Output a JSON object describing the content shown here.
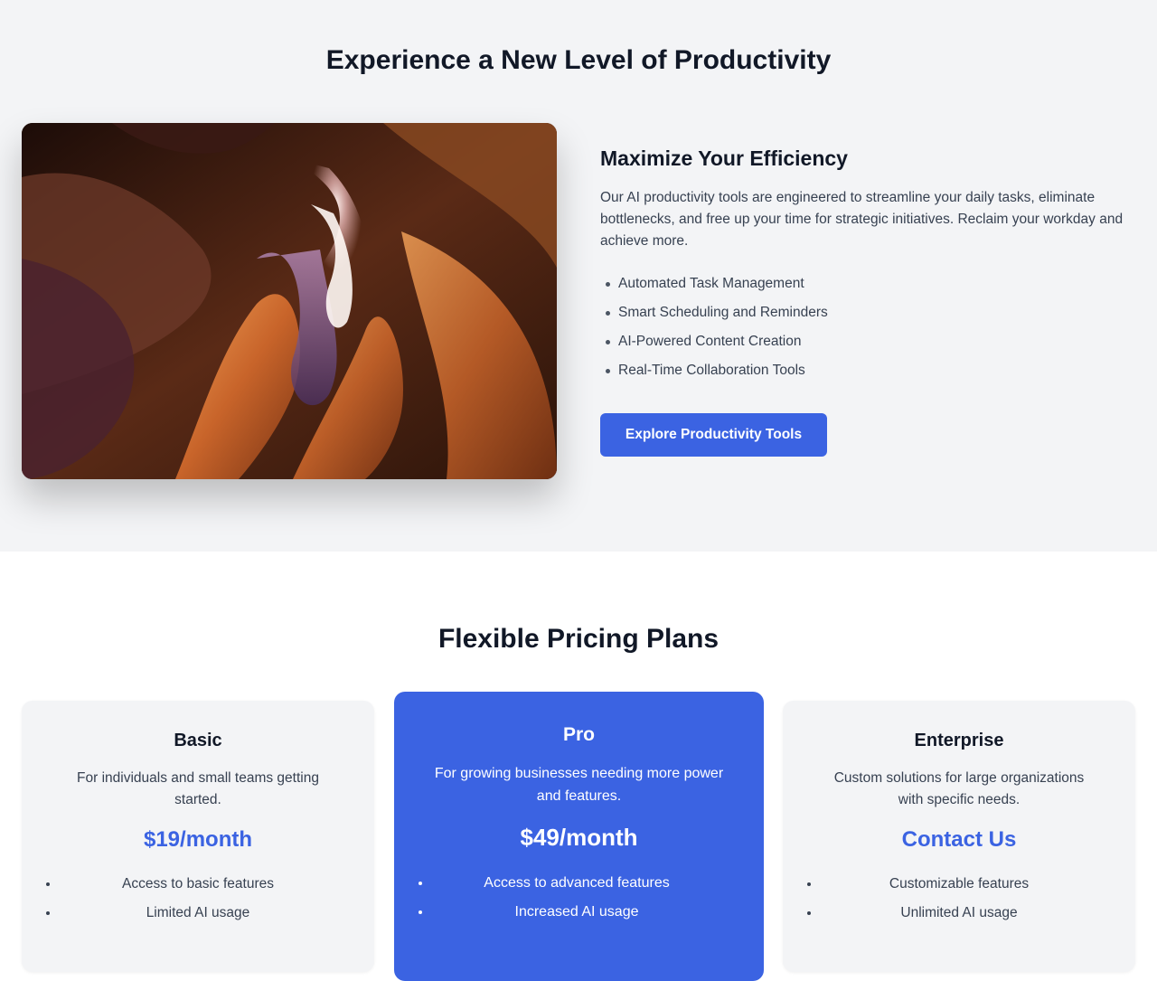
{
  "productivity": {
    "title": "Experience a New Level of Productivity",
    "image": {
      "alt": "canyon-photo"
    },
    "subtitle": "Maximize Your Efficiency",
    "description": "Our AI productivity tools are engineered to streamline your daily tasks, eliminate bottlenecks, and free up your time for strategic initiatives. Reclaim your workday and achieve more.",
    "features": [
      "Automated Task Management",
      "Smart Scheduling and Reminders",
      "AI-Powered Content Creation",
      "Real-Time Collaboration Tools"
    ],
    "cta_label": "Explore Productivity Tools"
  },
  "pricing": {
    "title": "Flexible Pricing Plans",
    "plans": [
      {
        "name": "Basic",
        "description": "For individuals and small teams getting started.",
        "price": "$19/month",
        "features": [
          "Access to basic features",
          "Limited AI usage"
        ]
      },
      {
        "name": "Pro",
        "description": "For growing businesses needing more power and features.",
        "price": "$49/month",
        "features": [
          "Access to advanced features",
          "Increased AI usage"
        ]
      },
      {
        "name": "Enterprise",
        "description": "Custom solutions for large organizations with specific needs.",
        "price": "Contact Us",
        "features": [
          "Customizable features",
          "Unlimited AI usage"
        ]
      }
    ]
  },
  "colors": {
    "accent": "#3b63e2",
    "section_bg": "#f3f4f6",
    "heading": "#111827",
    "body_text": "#374151"
  }
}
